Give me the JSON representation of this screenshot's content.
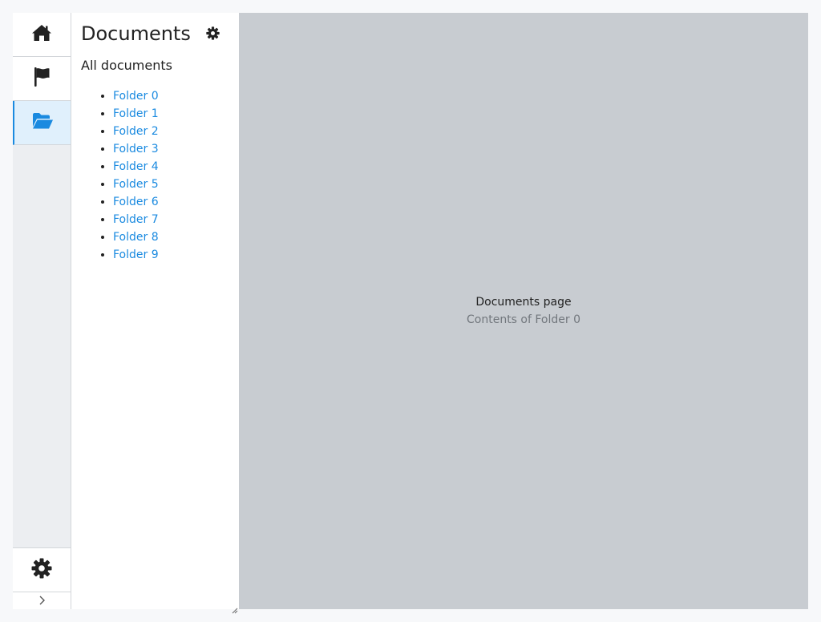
{
  "rail": {
    "items": [
      {
        "icon": "home-icon",
        "active": false
      },
      {
        "icon": "flag-icon",
        "active": false
      },
      {
        "icon": "folder-open-icon",
        "active": true
      }
    ],
    "settings_icon": "gear-icon",
    "expand_icon": "chevron-right-icon"
  },
  "panel": {
    "title": "Documents",
    "settings_icon": "gear-icon",
    "all_documents_label": "All documents",
    "folders": [
      "Folder 0",
      "Folder 1",
      "Folder 2",
      "Folder 3",
      "Folder 4",
      "Folder 5",
      "Folder 6",
      "Folder 7",
      "Folder 8",
      "Folder 9"
    ]
  },
  "main": {
    "title": "Documents page",
    "subtitle": "Contents of Folder 0"
  },
  "colors": {
    "accent": "#1a8ae0",
    "active_bg": "#e0f0fc",
    "icon": "#222222",
    "content_bg": "#c8ccd1"
  }
}
